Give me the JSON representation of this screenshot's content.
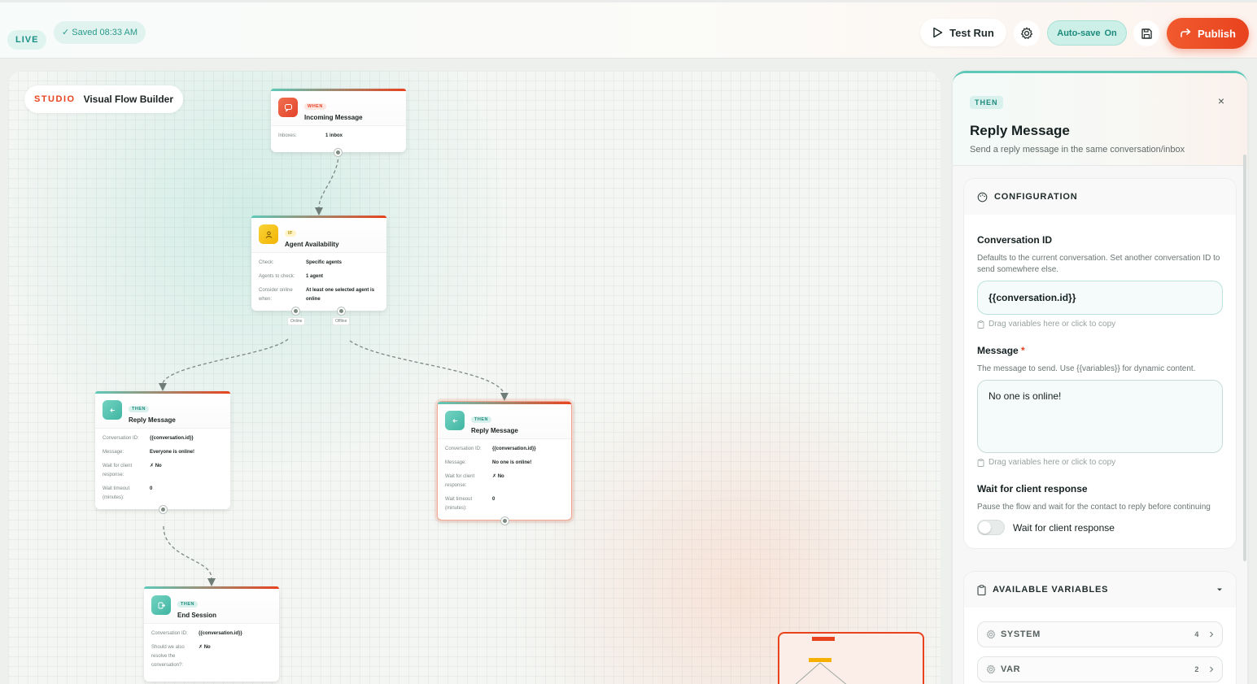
{
  "topbar": {
    "live": "LIVE",
    "saved": "✓ Saved 08:33 AM",
    "test_run": "Test Run",
    "autosave_label": "Auto-save",
    "autosave_state": "On",
    "publish": "Publish"
  },
  "canvas": {
    "studio": "STUDIO",
    "builder": "Visual Flow Builder",
    "nodes": {
      "incoming": {
        "tag": "WHEN",
        "title": "Incoming Message",
        "rows": [
          {
            "k": "Inboxes:",
            "v": "1 inbox"
          }
        ]
      },
      "agent": {
        "tag": "IF",
        "title": "Agent Availability",
        "rows": [
          {
            "k": "Check:",
            "v": "Specific agents"
          },
          {
            "k": "Agents to check:",
            "v": "1 agent"
          },
          {
            "k": "Consider online when:",
            "v": "At least one selected agent is online"
          }
        ],
        "port_online": "Online",
        "port_offline": "Offline"
      },
      "reply_left": {
        "tag": "THEN",
        "title": "Reply Message",
        "rows": [
          {
            "k": "Conversation ID:",
            "v": "{{conversation.id}}"
          },
          {
            "k": "Message:",
            "v": "Everyone is online!"
          },
          {
            "k": "Wait for client response:",
            "v": "✗ No"
          },
          {
            "k": "Wait timeout (minutes):",
            "v": "0"
          }
        ]
      },
      "reply_right": {
        "tag": "THEN",
        "title": "Reply Message",
        "rows": [
          {
            "k": "Conversation ID:",
            "v": "{{conversation.id}}"
          },
          {
            "k": "Message:",
            "v": "No one is online!"
          },
          {
            "k": "Wait for client response:",
            "v": "✗ No"
          },
          {
            "k": "Wait timeout (minutes):",
            "v": "0"
          }
        ]
      },
      "end": {
        "tag": "THEN",
        "title": "End Session",
        "rows": [
          {
            "k": "Conversation ID:",
            "v": "{{conversation.id}}"
          },
          {
            "k": "Should we also resolve the conversation?:",
            "v": "✗ No"
          }
        ]
      }
    }
  },
  "panel": {
    "tag": "THEN",
    "close": "×",
    "title": "Reply Message",
    "subtitle": "Send a reply message in the same conversation/inbox",
    "config_header": "CONFIGURATION",
    "conv_label": "Conversation ID",
    "conv_desc": "Defaults to the current conversation. Set another conversation ID to send somewhere else.",
    "conv_value": "{{conversation.id}}",
    "hint": "Drag variables here or click to copy",
    "msg_label": "Message",
    "msg_required": "*",
    "msg_desc": "The message to send. Use {{variables}} for dynamic content.",
    "msg_value": "No one is online!",
    "wait_label": "Wait for client response",
    "wait_desc": "Pause the flow and wait for the contact to reply before continuing",
    "wait_toggle_label": "Wait for client response",
    "vars_header": "AVAILABLE VARIABLES",
    "vars": [
      {
        "name": "SYSTEM",
        "count": "4"
      },
      {
        "name": "VAR",
        "count": "2"
      }
    ]
  },
  "colors": {
    "accent": "#e8431e",
    "teal": "#2a9a8c",
    "trigger_icon": "#ec5a3a",
    "condition_icon": "#f5c518",
    "action_icon": "#5cc8b5"
  }
}
